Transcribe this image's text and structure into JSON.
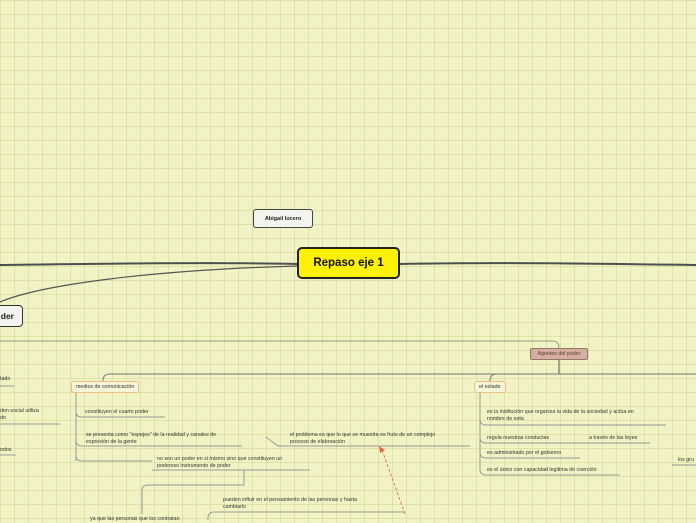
{
  "central": "Repaso eje 1",
  "author": "Abigail lucero",
  "poder": "der",
  "agentes": "Agentes del poder",
  "medios": {
    "label": "medios de comunicación",
    "item1": "constituyen el cuarto poder",
    "item2_l1": "se presenta como \"espejos\" de la realidad y canales de",
    "item2_l2": "expresión de la gente",
    "problema_l1": "el problema es que lo que se muestra es fruto de un complejo",
    "problema_l2": "proceso de elaboración",
    "item3_l1": "no son un poder en si mismo sino que constituyen un",
    "item3_l2": "poderoso instrumento de poder",
    "influir_l1": "pueden influir en el  pensamiento de las personas y hasta",
    "influir_l2": "cambiarlo",
    "bottom": "ya que las personas que los contratan"
  },
  "estado": {
    "label": "el estado",
    "item1_l1": "es la institución que organiza la vida de la sociedad y actúa en",
    "item1_l2": "nombre de esta",
    "item2": "regula nuestras conductas",
    "item2b": "a través de las leyes",
    "item3": "es administrado por el gobierno",
    "item4": "es el único con capacidad legitima de coerción"
  },
  "left": {
    "t1": "tado",
    "t2_l1": "den social utiliza",
    "t2_l2": "do",
    "t3": "odos"
  },
  "right": {
    "t1": "los gru"
  }
}
